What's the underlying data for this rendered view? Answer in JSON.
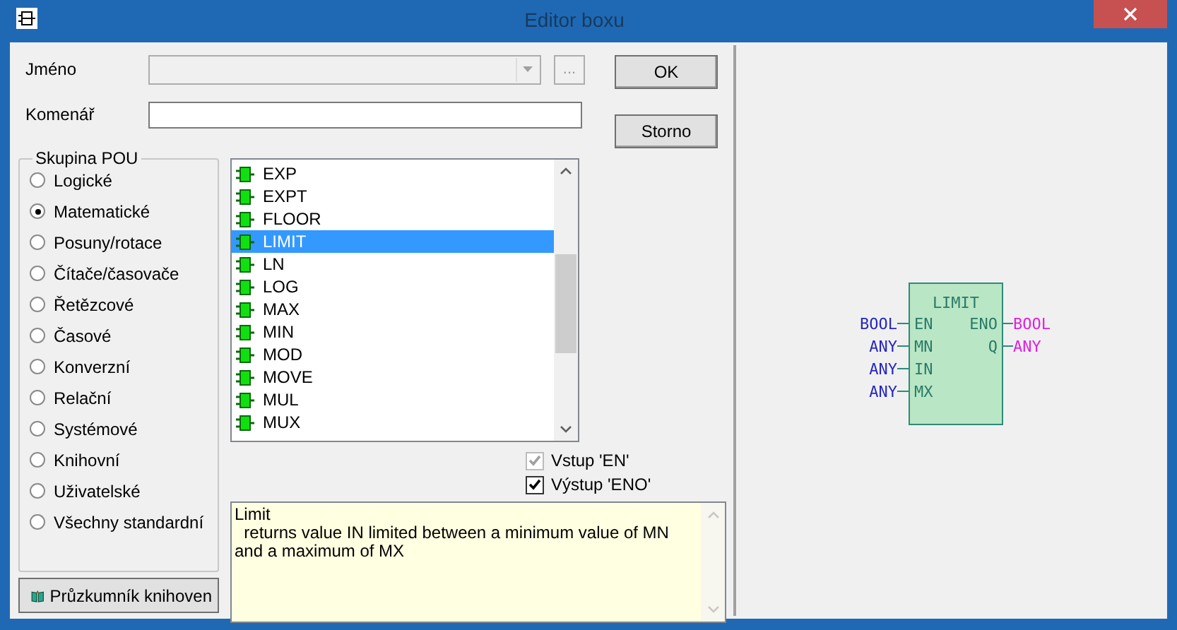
{
  "window": {
    "title": "Editor boxu"
  },
  "name_field": {
    "label": "Jméno",
    "browse": "...",
    "disabled": true
  },
  "comment_field": {
    "label": "Komenář"
  },
  "buttons": {
    "ok": "OK",
    "cancel": "Storno"
  },
  "group": {
    "title": "Skupina POU",
    "options": [
      {
        "label": "Logické",
        "selected": false
      },
      {
        "label": "Matematické",
        "selected": true
      },
      {
        "label": "Posuny/rotace",
        "selected": false
      },
      {
        "label": "Čítače/časovače",
        "selected": false
      },
      {
        "label": "Řetězcové",
        "selected": false
      },
      {
        "label": "Časové",
        "selected": false
      },
      {
        "label": "Konverzní",
        "selected": false
      },
      {
        "label": "Relační",
        "selected": false
      },
      {
        "label": "Systémové",
        "selected": false
      },
      {
        "label": "Knihovní",
        "selected": false
      },
      {
        "label": "Uživatelské",
        "selected": false
      },
      {
        "label": "Všechny standardní",
        "selected": false
      }
    ]
  },
  "library_button": "Průzkumník knihoven",
  "function_list": [
    {
      "name": "EXP",
      "selected": false
    },
    {
      "name": "EXPT",
      "selected": false
    },
    {
      "name": "FLOOR",
      "selected": false
    },
    {
      "name": "LIMIT",
      "selected": true
    },
    {
      "name": "LN",
      "selected": false
    },
    {
      "name": "LOG",
      "selected": false
    },
    {
      "name": "MAX",
      "selected": false
    },
    {
      "name": "MIN",
      "selected": false
    },
    {
      "name": "MOD",
      "selected": false
    },
    {
      "name": "MOVE",
      "selected": false
    },
    {
      "name": "MUL",
      "selected": false
    },
    {
      "name": "MUX",
      "selected": false
    }
  ],
  "options": [
    {
      "label": "Vstup 'EN'",
      "checked": true,
      "disabled": true
    },
    {
      "label": "Výstup 'ENO'",
      "checked": true,
      "disabled": false
    }
  ],
  "description": "Limit\n  returns value IN limited between a minimum value of MN and a maximum of MX",
  "preview": {
    "name": "LIMIT",
    "inputs": [
      {
        "type": "BOOL",
        "pin": "EN"
      },
      {
        "type": "ANY",
        "pin": "MN"
      },
      {
        "type": "ANY",
        "pin": "IN"
      },
      {
        "type": "ANY",
        "pin": "MX"
      }
    ],
    "outputs": [
      {
        "pin": "ENO",
        "type": "BOOL"
      },
      {
        "pin": "Q",
        "type": "ANY"
      }
    ]
  }
}
